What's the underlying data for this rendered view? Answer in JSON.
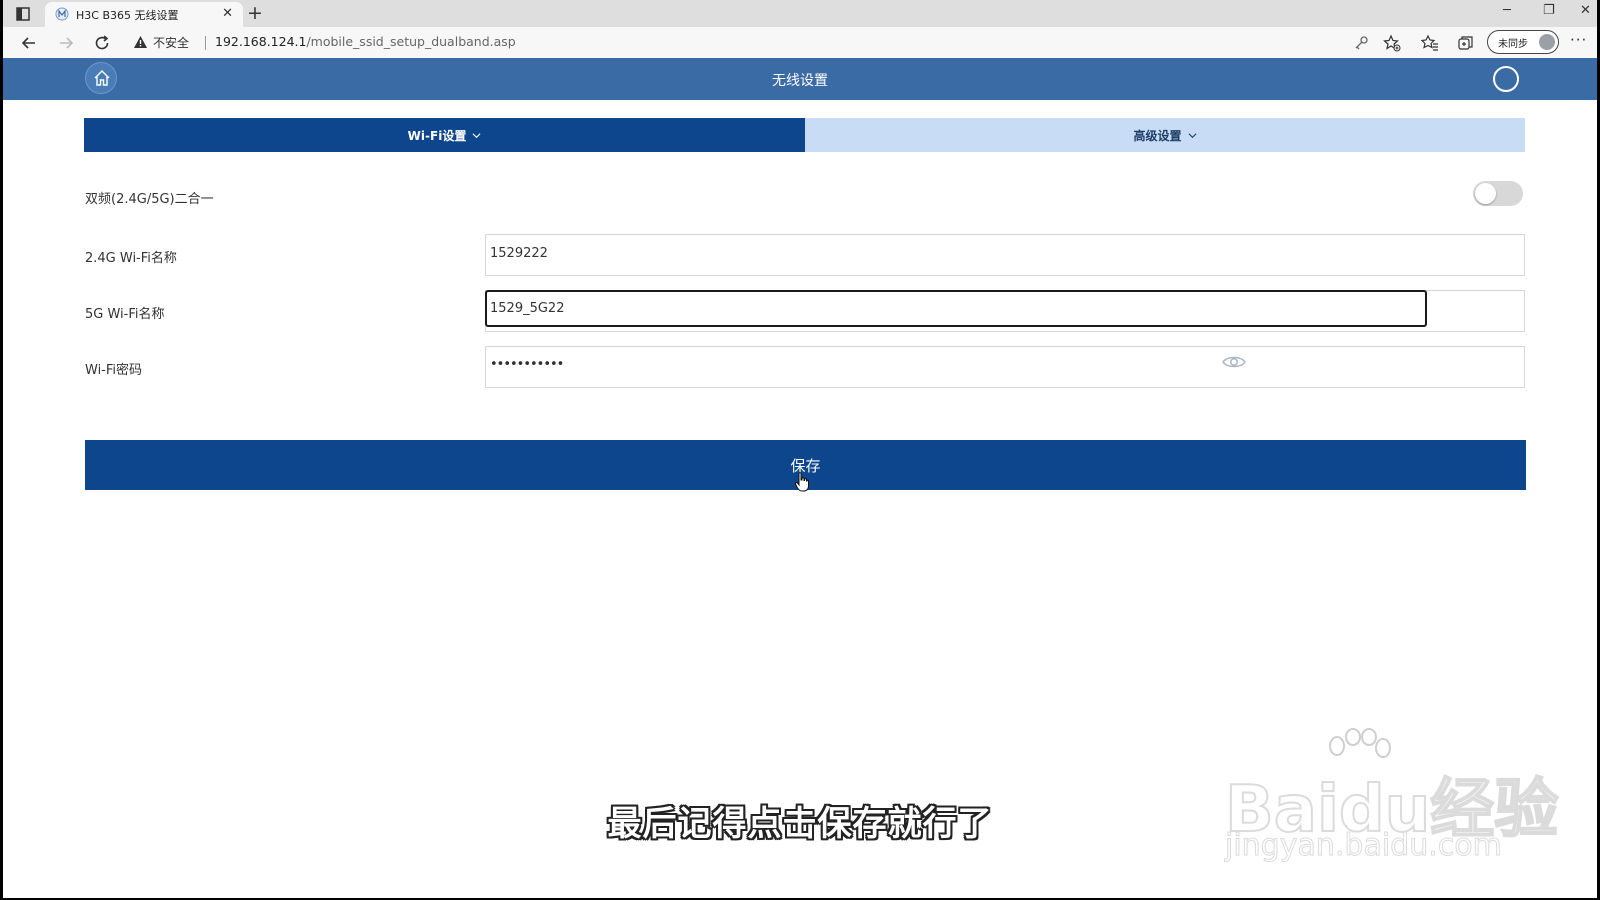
{
  "browser": {
    "tab_title": "H3C B365 无线设置",
    "tab_close": "✕",
    "new_tab": "+",
    "insecure_label": "不安全",
    "url_host": "192.168.124.1",
    "url_path": "/mobile_ssid_setup_dualband.asp",
    "profile_label": "未同步",
    "more_label": "···",
    "minimize": "─",
    "restore": "❐",
    "close": "✕"
  },
  "header": {
    "title": "无线设置"
  },
  "tabs": [
    {
      "label": "Wi-Fi设置",
      "active": true
    },
    {
      "label": "高级设置",
      "active": false
    }
  ],
  "form": {
    "dualband_label": "双频(2.4G/5G)二合一",
    "dualband_enabled": false,
    "wifi24_label": "2.4G Wi-Fi名称",
    "wifi24_value": "1529222",
    "wifi5_label": "5G Wi-Fi名称",
    "wifi5_value": "1529_5G22",
    "password_label": "Wi-Fi密码",
    "password_masked": "•••••••••••"
  },
  "save_label": "保存",
  "caption": "最后记得点击保存就行了",
  "watermark": {
    "logo": "Baidu经验",
    "url": "jingyan.baidu.com"
  },
  "colors": {
    "header_bg": "#3b6ba5",
    "primary": "#0d468c",
    "tab_inactive_bg": "#c8dcf5"
  }
}
